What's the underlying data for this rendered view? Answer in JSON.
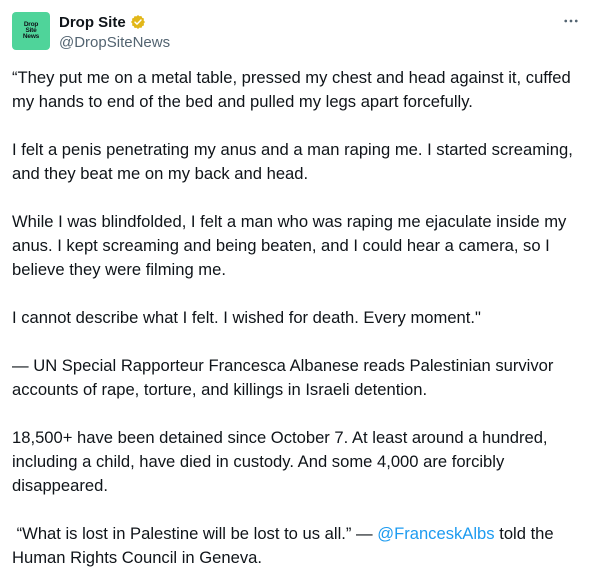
{
  "avatar": {
    "lines": [
      "Drop",
      "Site",
      "News"
    ],
    "color": "#4fd49a"
  },
  "author": {
    "name": "Drop Site",
    "handle": "@DropSiteNews",
    "verified_icon": "verified-badge-icon",
    "verified_color": "#e2b719"
  },
  "menu": {
    "icon": "more-options-icon"
  },
  "tweet": {
    "p1": "“They put me on a metal table, pressed my chest and head against it, cuffed my hands to end of the bed and pulled my legs apart forcefully.",
    "p2": "I felt a penis penetrating my anus and a man raping me. I started screaming, and they beat me on my back and head.",
    "p3": "While I was blindfolded, I felt a man who was raping me ejaculate inside my anus. I kept screaming and being beaten, and I could hear a camera, so I believe they were filming me.",
    "p4": "I cannot describe what I felt. I wished for death. Every moment.\"",
    "p5": "— UN Special Rapporteur Francesca Albanese reads Palestinian survivor accounts of rape, torture, and killings in Israeli detention.",
    "p6": "18,500+ have been detained since October 7. At least around a hundred, including a child, have died in custody. And some 4,000 are forcibly disappeared.",
    "p7_before": " “What is lost in Palestine will be lost to us all.” — ",
    "p7_mention": "@FranceskAlbs",
    "p7_after": " told the Human Rights Council in Geneva."
  },
  "colors": {
    "text": "#0f1419",
    "secondary": "#536471",
    "link": "#1d9bf0"
  }
}
